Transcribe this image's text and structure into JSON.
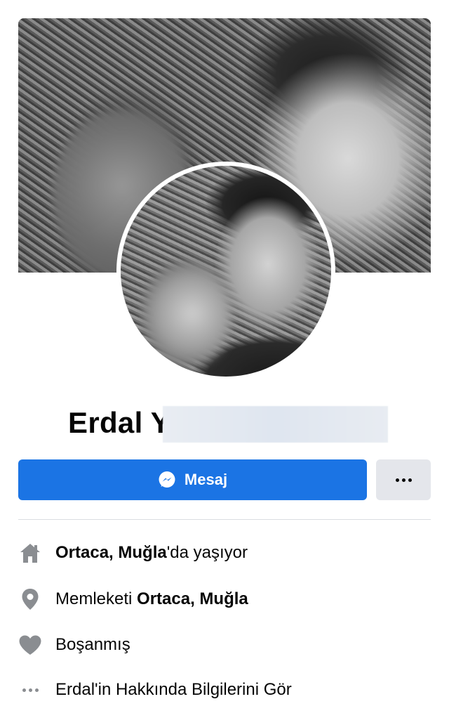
{
  "profile": {
    "name": "Erdal Y",
    "message_label": "Mesaj"
  },
  "info": {
    "lives_in": {
      "city": "Ortaca, Muğla",
      "suffix": "'da yaşıyor"
    },
    "hometown": {
      "prefix": "Memleketi ",
      "city": "Ortaca, Muğla"
    },
    "relationship": "Boşanmış",
    "see_about": "Erdal'in Hakkında Bilgilerini Gör"
  },
  "icons": {
    "home": "home-icon",
    "location": "location-pin-icon",
    "relationship": "heart-icon",
    "more": "more-dots-icon",
    "messenger": "messenger-icon"
  },
  "colors": {
    "primary": "#1b74e4",
    "secondary_button": "#e4e6eb",
    "icon_gray": "#8a8d91",
    "divider": "#dadde1"
  }
}
